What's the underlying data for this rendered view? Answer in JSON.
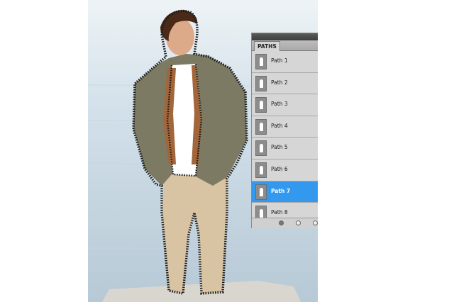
{
  "panel": {
    "title": "PATHS",
    "selected_color": "#3399ee",
    "paths": [
      {
        "label": "Path 1",
        "selected": false
      },
      {
        "label": "Path 2",
        "selected": false
      },
      {
        "label": "Path 3",
        "selected": false
      },
      {
        "label": "Path 4",
        "selected": false
      },
      {
        "label": "Path 5",
        "selected": false
      },
      {
        "label": "Path 6",
        "selected": false
      },
      {
        "label": "Path 7",
        "selected": true
      },
      {
        "label": "Path 8",
        "selected": false
      }
    ],
    "footer_icons": [
      "fill-path-icon",
      "stroke-path-icon",
      "load-selection-icon"
    ]
  }
}
